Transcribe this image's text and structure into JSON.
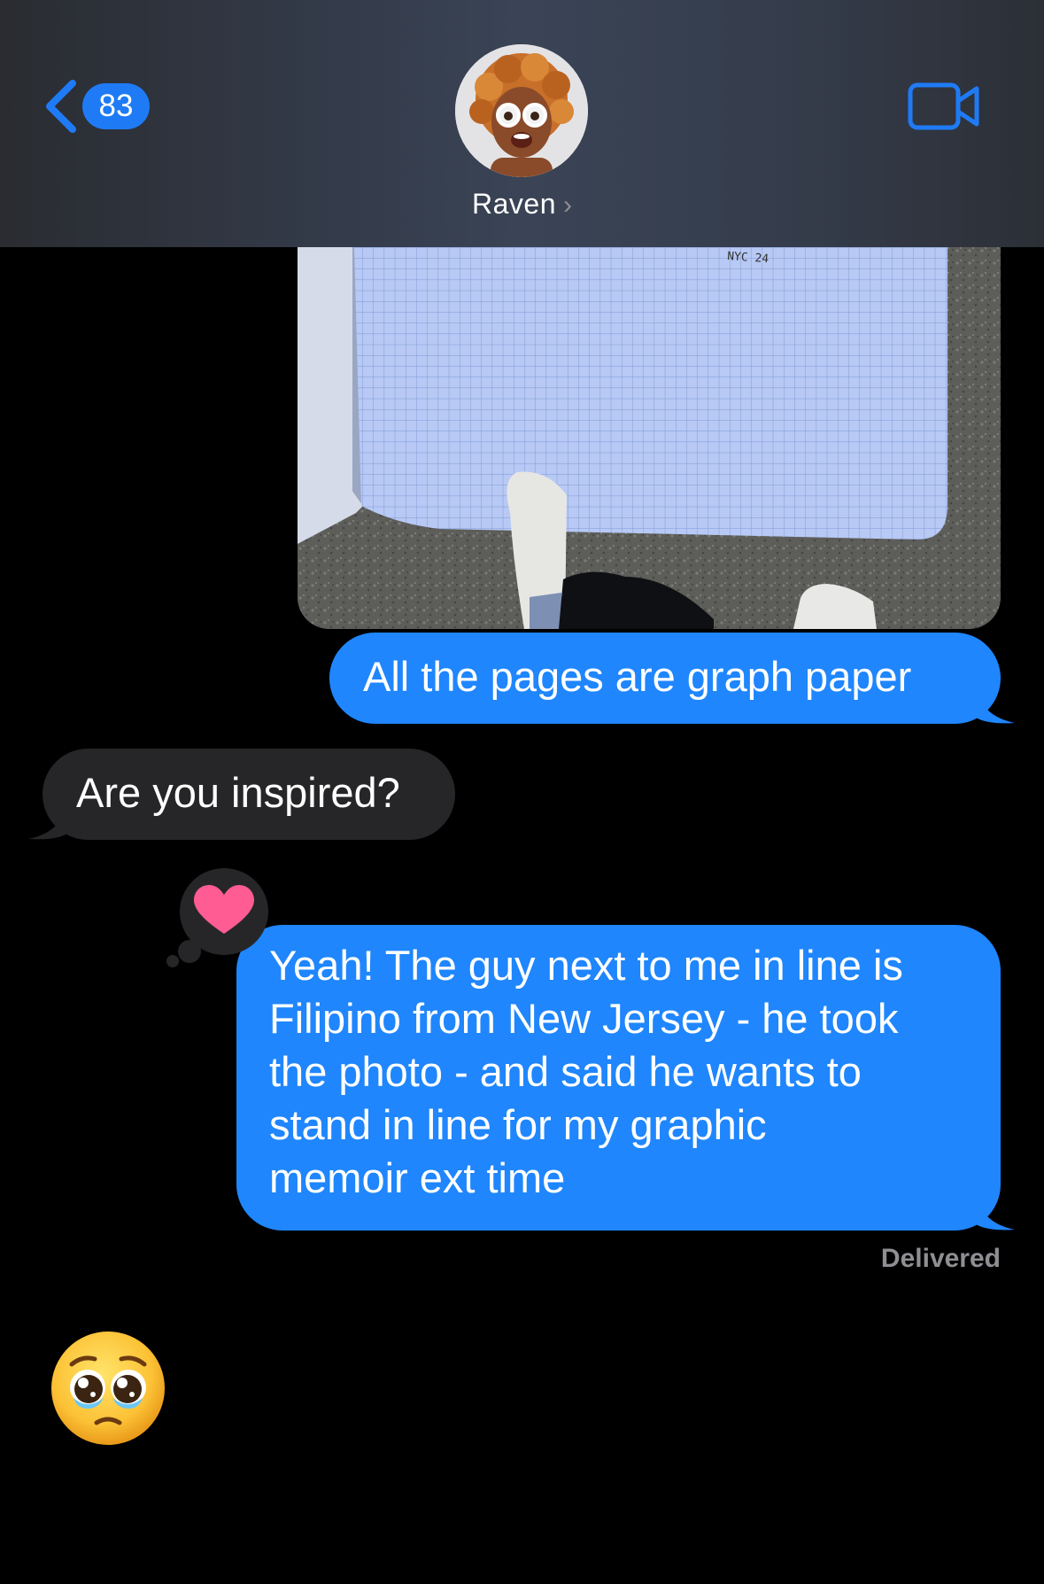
{
  "header": {
    "back_count": "83",
    "contact_name": "Raven",
    "name_chevron": "›"
  },
  "icons": {
    "back": "chevron-left-icon",
    "video": "video-camera-icon",
    "tapback": "heart-icon"
  },
  "colors": {
    "accent": "#1f7bf5",
    "outgoing_bubble": "#1f86fd",
    "incoming_bubble": "#262628",
    "heart": "#ff5c94",
    "meta_text": "#8e8e93"
  },
  "messages": [
    {
      "type": "image",
      "direction": "outgoing",
      "image_text": "NYC 24"
    },
    {
      "type": "text",
      "direction": "outgoing",
      "text": "All the pages are graph paper"
    },
    {
      "type": "text",
      "direction": "incoming",
      "text": "Are you inspired?"
    },
    {
      "type": "text",
      "direction": "outgoing",
      "lines": [
        "Yeah! The guy next to me in line is",
        "Filipino from New Jersey - he took",
        "the photo - and said he wants to",
        "stand in line for my graphic",
        "memoir  ext time"
      ],
      "reaction": "heart",
      "status": "Delivered"
    },
    {
      "type": "emoji",
      "direction": "incoming",
      "emoji": "pleading-face"
    }
  ]
}
